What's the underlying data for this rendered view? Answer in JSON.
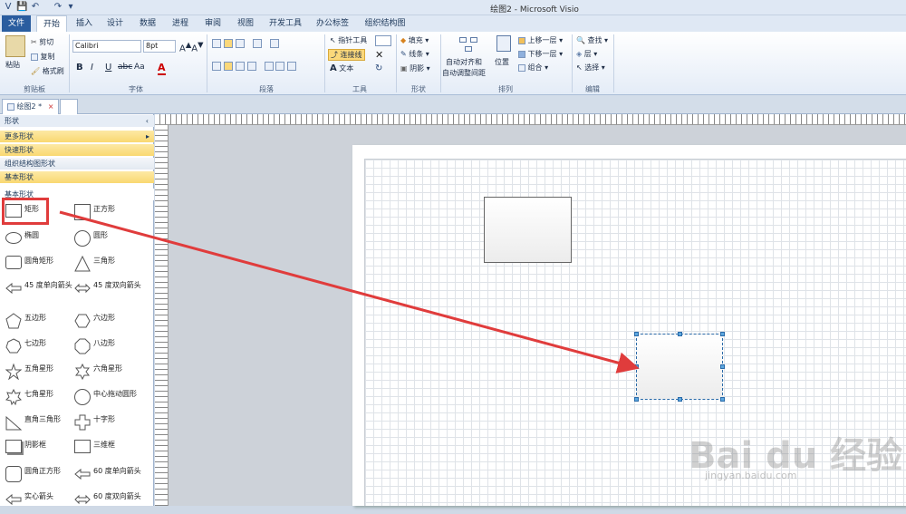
{
  "window": {
    "title": "绘图2 - Microsoft Visio"
  },
  "quick_access": [
    "V",
    "💾",
    "↶",
    "↷",
    "▾"
  ],
  "tabs": [
    "文件",
    "开始",
    "插入",
    "设计",
    "数据",
    "进程",
    "审阅",
    "视图",
    "开发工具",
    "办公标签",
    "组织结构图"
  ],
  "ribbon": {
    "clipboard": {
      "paste": "粘贴",
      "cut": "剪切",
      "copy": "复制",
      "format_painter": "格式刷",
      "group": "剪贴板"
    },
    "font": {
      "family": "Calibri",
      "size": "8pt",
      "group": "字体",
      "bold": "B",
      "italic": "I",
      "underline": "U",
      "strike": "abc",
      "case": "Aa",
      "color": "A"
    },
    "paragraph": {
      "group": "段落"
    },
    "tools": {
      "pointer": "指针工具",
      "connector": "连接线",
      "text": "文本",
      "group": "工具"
    },
    "shape": {
      "fill": "填充",
      "line": "线条",
      "shadow": "阴影",
      "group": "形状"
    },
    "arrange": {
      "auto_align": "自动对齐和",
      "auto_space": "自动调整间距",
      "position": "位置",
      "bring_forward": "上移一层",
      "send_backward": "下移一层",
      "group_btn": "组合",
      "group": "排列"
    },
    "editing": {
      "find": "查找",
      "layers": "层",
      "select": "选择",
      "group": "编辑"
    }
  },
  "doc_tab": {
    "label": "绘图2 *",
    "close": "×"
  },
  "shapes_panel": {
    "title": "形状",
    "collapse": "‹",
    "more_shapes": "更多形状",
    "more_arrow": "▸",
    "quick_shapes": "快速形状",
    "org_chart_shapes": "组织结构图形状",
    "basic_shapes": "基本形状",
    "section_title": "基本形状",
    "items": [
      {
        "left": "矩形",
        "right": "正方形"
      },
      {
        "left": "椭圆",
        "right": "圆形"
      },
      {
        "left": "圆角矩形",
        "right": "三角形"
      },
      {
        "left": "45 度单向箭头",
        "right": "45 度双向箭头"
      },
      {
        "left": "五边形",
        "right": "六边形"
      },
      {
        "left": "七边形",
        "right": "八边形"
      },
      {
        "left": "五角星形",
        "right": "六角星形"
      },
      {
        "left": "七角星形",
        "right": "中心拖动圆形"
      },
      {
        "left": "直角三角形",
        "right": "十字形"
      },
      {
        "left": "阴影框",
        "right": "三维框"
      },
      {
        "left": "圆角正方形",
        "right": "60 度单向箭头"
      },
      {
        "left": "实心箭头",
        "right": "60 度双向箭头"
      }
    ]
  },
  "watermark": {
    "brand": "Bai du 经验",
    "url": "jingyan.baidu.com"
  },
  "colors": {
    "highlight_red": "#e03c3c",
    "selection_blue": "#2a6aa8",
    "panel_active": "#fbd87a"
  }
}
